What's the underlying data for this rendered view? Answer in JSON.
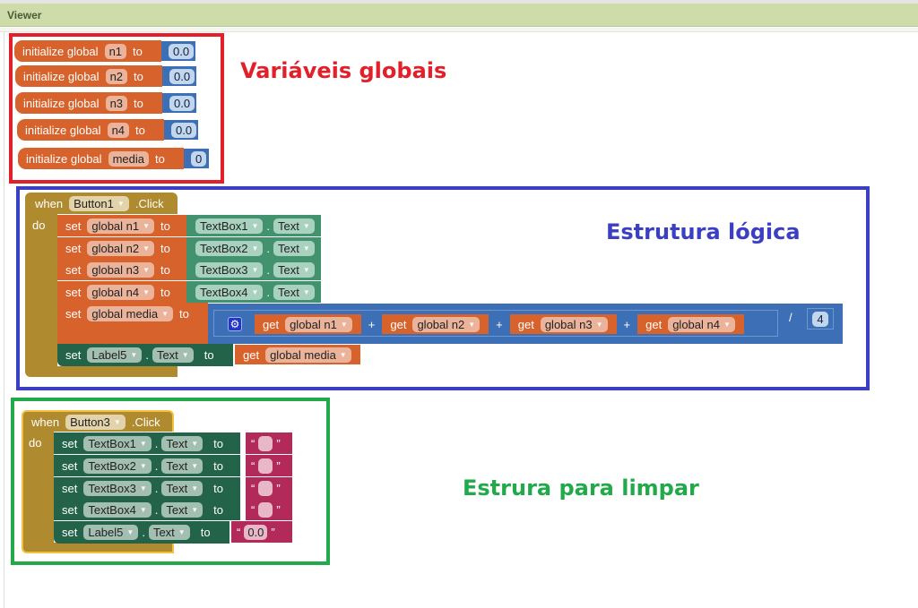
{
  "viewer": {
    "title": "Viewer"
  },
  "annotations": {
    "globals": "Variáveis globais",
    "logic": "Estrutura lógica",
    "clear": "Estrura para limpar"
  },
  "colors": {
    "globals_frame": "#e3202a",
    "logic_frame": "#3b3fc1",
    "clear_frame": "#21a94a",
    "variable_block": "#d7622b",
    "math_block": "#3d6fb6",
    "component_getter": "#42936d",
    "component_setter": "#23634a",
    "event_block": "#b08a2f",
    "text_block": "#b22a5a"
  },
  "globals": [
    {
      "prefix": "initialize global",
      "name": "n1",
      "to": "to",
      "value": "0.0"
    },
    {
      "prefix": "initialize global",
      "name": "n2",
      "to": "to",
      "value": "0.0"
    },
    {
      "prefix": "initialize global",
      "name": "n3",
      "to": "to",
      "value": "0.0"
    },
    {
      "prefix": "initialize global",
      "name": "n4",
      "to": "to",
      "value": "0.0"
    },
    {
      "prefix": "initialize global",
      "name": "media",
      "to": "to",
      "value": "0"
    }
  ],
  "event1": {
    "when": "when",
    "component": "Button1",
    "event": ".Click",
    "do": "do",
    "sets": [
      {
        "set": "set",
        "var": "global n1",
        "to": "to",
        "component": "TextBox1",
        "prop": "Text"
      },
      {
        "set": "set",
        "var": "global n2",
        "to": "to",
        "component": "TextBox2",
        "prop": "Text"
      },
      {
        "set": "set",
        "var": "global n3",
        "to": "to",
        "component": "TextBox3",
        "prop": "Text"
      },
      {
        "set": "set",
        "var": "global n4",
        "to": "to",
        "component": "TextBox4",
        "prop": "Text"
      }
    ],
    "media": {
      "set": "set",
      "var": "global media",
      "to": "to",
      "gets": [
        {
          "get": "get",
          "var": "global n1"
        },
        {
          "get": "get",
          "var": "global n2"
        },
        {
          "get": "get",
          "var": "global n3"
        },
        {
          "get": "get",
          "var": "global n4"
        }
      ],
      "plus": "+",
      "divide": "/",
      "divisor": "4"
    },
    "label": {
      "set": "set",
      "component": "Label5",
      "prop": "Text",
      "to": "to",
      "get": "get",
      "var": "global media"
    }
  },
  "event2": {
    "when": "when",
    "component": "Button3",
    "event": ".Click",
    "do": "do",
    "sets": [
      {
        "set": "set",
        "component": "TextBox1",
        "prop": "Text",
        "to": "to",
        "value": ""
      },
      {
        "set": "set",
        "component": "TextBox2",
        "prop": "Text",
        "to": "to",
        "value": ""
      },
      {
        "set": "set",
        "component": "TextBox3",
        "prop": "Text",
        "to": "to",
        "value": ""
      },
      {
        "set": "set",
        "component": "TextBox4",
        "prop": "Text",
        "to": "to",
        "value": ""
      },
      {
        "set": "set",
        "component": "Label5",
        "prop": "Text",
        "to": "to",
        "value": "0.0"
      }
    ],
    "open_quote": "“",
    "close_quote": "”"
  }
}
